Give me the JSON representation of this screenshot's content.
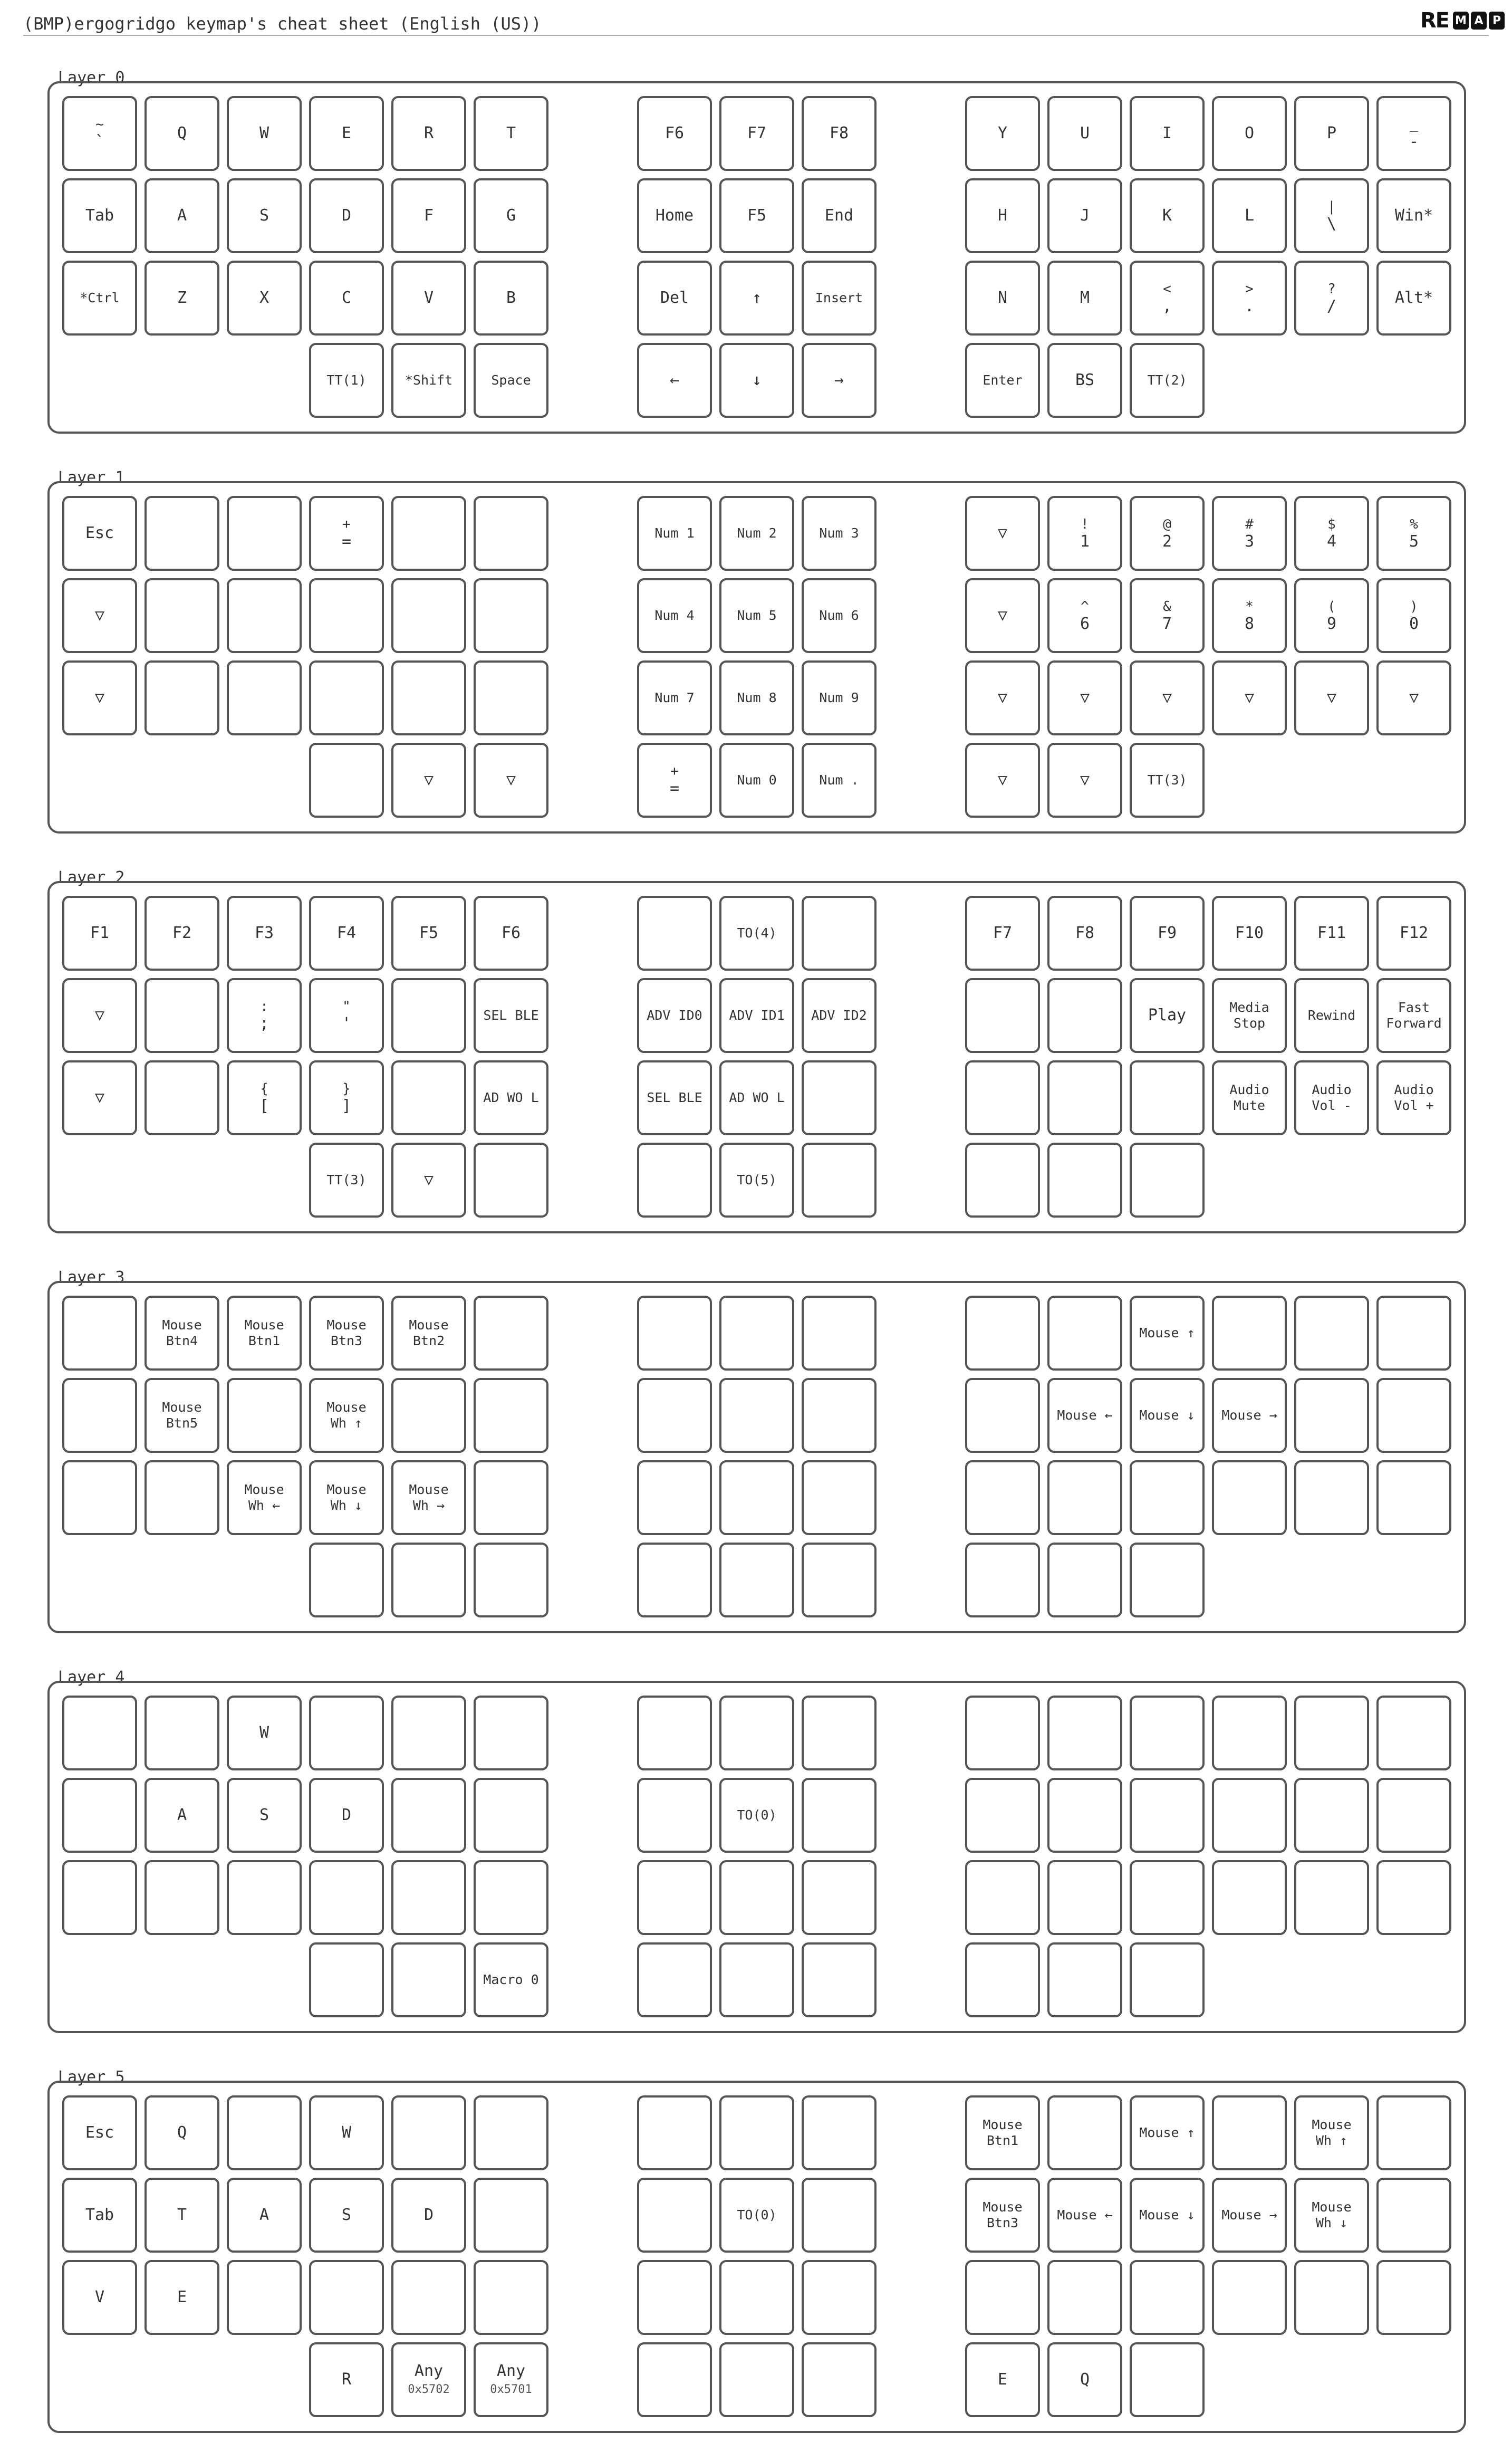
{
  "header": {
    "title": "(BMP)ergogridgo keymap's cheat sheet (English (US))",
    "logo_text": "RE",
    "logo_boxes": [
      "M",
      "A",
      "P"
    ]
  },
  "layers": [
    {
      "label": "Layer 0",
      "rows": [
        [
          {
            "top": "~",
            "main": "`"
          },
          {
            "main": "Q"
          },
          {
            "main": "W"
          },
          {
            "main": "E"
          },
          {
            "main": "R"
          },
          {
            "main": "T"
          },
          {
            "main": "F6"
          },
          {
            "main": "F7"
          },
          {
            "main": "F8"
          },
          {
            "main": "Y"
          },
          {
            "main": "U"
          },
          {
            "main": "I"
          },
          {
            "main": "O"
          },
          {
            "main": "P"
          },
          {
            "top": "_",
            "main": "-"
          }
        ],
        [
          {
            "main": "Tab"
          },
          {
            "main": "A"
          },
          {
            "main": "S"
          },
          {
            "main": "D"
          },
          {
            "main": "F"
          },
          {
            "main": "G"
          },
          {
            "main": "Home"
          },
          {
            "main": "F5"
          },
          {
            "main": "End"
          },
          {
            "main": "H"
          },
          {
            "main": "J"
          },
          {
            "main": "K"
          },
          {
            "main": "L"
          },
          {
            "top": "|",
            "main": "\\"
          },
          {
            "main": "Win*"
          }
        ],
        [
          {
            "main": "*Ctrl",
            "sm": true
          },
          {
            "main": "Z"
          },
          {
            "main": "X"
          },
          {
            "main": "C"
          },
          {
            "main": "V"
          },
          {
            "main": "B"
          },
          {
            "main": "Del"
          },
          {
            "main": "↑"
          },
          {
            "main": "Insert",
            "sm": true
          },
          {
            "main": "N"
          },
          {
            "main": "M"
          },
          {
            "top": "<",
            "main": ","
          },
          {
            "top": ">",
            "main": "."
          },
          {
            "top": "?",
            "main": "/"
          },
          {
            "main": "Alt*"
          }
        ],
        [
          null,
          null,
          null,
          {
            "main": "TT(1)",
            "sm": true
          },
          {
            "main": "*Shift",
            "sm": true
          },
          {
            "main": "Space",
            "sm": true
          },
          {
            "main": "←"
          },
          {
            "main": "↓"
          },
          {
            "main": "→"
          },
          {
            "main": "Enter",
            "sm": true
          },
          {
            "main": "BS"
          },
          {
            "main": "TT(2)",
            "sm": true
          },
          null,
          null,
          null
        ]
      ]
    },
    {
      "label": "Layer 1",
      "rows": [
        [
          {
            "main": "Esc"
          },
          {},
          {},
          {
            "top": "+",
            "main": "="
          },
          {},
          {},
          {
            "main": "Num 1",
            "sm": true
          },
          {
            "main": "Num 2",
            "sm": true
          },
          {
            "main": "Num 3",
            "sm": true
          },
          {
            "main": "▽"
          },
          {
            "top": "!",
            "main": "1"
          },
          {
            "top": "@",
            "main": "2"
          },
          {
            "top": "#",
            "main": "3"
          },
          {
            "top": "$",
            "main": "4"
          },
          {
            "top": "%",
            "main": "5"
          }
        ],
        [
          {
            "main": "▽"
          },
          {},
          {},
          {},
          {},
          {},
          {
            "main": "Num 4",
            "sm": true
          },
          {
            "main": "Num 5",
            "sm": true
          },
          {
            "main": "Num 6",
            "sm": true
          },
          {
            "main": "▽"
          },
          {
            "top": "^",
            "main": "6"
          },
          {
            "top": "&",
            "main": "7"
          },
          {
            "top": "*",
            "main": "8"
          },
          {
            "top": "(",
            "main": "9"
          },
          {
            "top": ")",
            "main": "0"
          }
        ],
        [
          {
            "main": "▽"
          },
          {},
          {},
          {},
          {},
          {},
          {
            "main": "Num 7",
            "sm": true
          },
          {
            "main": "Num 8",
            "sm": true
          },
          {
            "main": "Num 9",
            "sm": true
          },
          {
            "main": "▽"
          },
          {
            "main": "▽"
          },
          {
            "main": "▽"
          },
          {
            "main": "▽"
          },
          {
            "main": "▽"
          },
          {
            "main": "▽"
          }
        ],
        [
          null,
          null,
          null,
          {},
          {
            "main": "▽"
          },
          {
            "main": "▽"
          },
          {
            "top": "+",
            "main": "="
          },
          {
            "main": "Num 0",
            "sm": true
          },
          {
            "main": "Num .",
            "sm": true
          },
          {
            "main": "▽"
          },
          {
            "main": "▽"
          },
          {
            "main": "TT(3)",
            "sm": true
          },
          null,
          null,
          null
        ]
      ]
    },
    {
      "label": "Layer 2",
      "rows": [
        [
          {
            "main": "F1"
          },
          {
            "main": "F2"
          },
          {
            "main": "F3"
          },
          {
            "main": "F4"
          },
          {
            "main": "F5"
          },
          {
            "main": "F6"
          },
          {},
          {
            "main": "TO(4)",
            "sm": true
          },
          {},
          {
            "main": "F7"
          },
          {
            "main": "F8"
          },
          {
            "main": "F9"
          },
          {
            "main": "F10"
          },
          {
            "main": "F11"
          },
          {
            "main": "F12"
          }
        ],
        [
          {
            "main": "▽"
          },
          {},
          {
            "top": ":",
            "main": ";"
          },
          {
            "top": "\"",
            "main": "'"
          },
          {},
          {
            "main": "SEL BLE",
            "sm": true
          },
          {
            "main": "ADV ID0",
            "sm": true
          },
          {
            "main": "ADV ID1",
            "sm": true
          },
          {
            "main": "ADV ID2",
            "sm": true
          },
          {},
          {},
          {
            "main": "Play"
          },
          {
            "main": "Media\nStop",
            "sm": true
          },
          {
            "main": "Rewind",
            "sm": true
          },
          {
            "main": "Fast\nForward",
            "sm": true
          }
        ],
        [
          {
            "main": "▽"
          },
          {},
          {
            "top": "{",
            "main": "["
          },
          {
            "top": "}",
            "main": "]"
          },
          {},
          {
            "main": "AD WO L",
            "sm": true
          },
          {
            "main": "SEL BLE",
            "sm": true
          },
          {
            "main": "AD WO L",
            "sm": true
          },
          {},
          {},
          {},
          {},
          {
            "main": "Audio\nMute",
            "sm": true
          },
          {
            "main": "Audio\nVol -",
            "sm": true
          },
          {
            "main": "Audio\nVol +",
            "sm": true
          }
        ],
        [
          null,
          null,
          null,
          {
            "main": "TT(3)",
            "sm": true
          },
          {
            "main": "▽"
          },
          {},
          {},
          {
            "main": "TO(5)",
            "sm": true
          },
          {},
          {},
          {},
          {},
          null,
          null,
          null
        ]
      ]
    },
    {
      "label": "Layer 3",
      "rows": [
        [
          {},
          {
            "main": "Mouse\nBtn4",
            "sm": true
          },
          {
            "main": "Mouse\nBtn1",
            "sm": true
          },
          {
            "main": "Mouse\nBtn3",
            "sm": true
          },
          {
            "main": "Mouse\nBtn2",
            "sm": true
          },
          {},
          {},
          {},
          {},
          {},
          {},
          {
            "main": "Mouse ↑",
            "sm": true
          },
          {},
          {},
          {}
        ],
        [
          {},
          {
            "main": "Mouse\nBtn5",
            "sm": true
          },
          {},
          {
            "main": "Mouse\nWh ↑",
            "sm": true
          },
          {},
          {},
          {},
          {},
          {},
          {},
          {
            "main": "Mouse ←",
            "sm": true
          },
          {
            "main": "Mouse ↓",
            "sm": true
          },
          {
            "main": "Mouse →",
            "sm": true
          },
          {},
          {}
        ],
        [
          {},
          {},
          {
            "main": "Mouse\nWh ←",
            "sm": true
          },
          {
            "main": "Mouse\nWh ↓",
            "sm": true
          },
          {
            "main": "Mouse\nWh →",
            "sm": true
          },
          {},
          {},
          {},
          {},
          {},
          {},
          {},
          {},
          {},
          {}
        ],
        [
          null,
          null,
          null,
          {},
          {},
          {},
          {},
          {},
          {},
          {},
          {},
          {},
          null,
          null,
          null
        ]
      ]
    },
    {
      "label": "Layer 4",
      "rows": [
        [
          {},
          {},
          {
            "main": "W"
          },
          {},
          {},
          {},
          {},
          {},
          {},
          {},
          {},
          {},
          {},
          {},
          {}
        ],
        [
          {},
          {
            "main": "A"
          },
          {
            "main": "S"
          },
          {
            "main": "D"
          },
          {},
          {},
          {},
          {
            "main": "TO(0)",
            "sm": true
          },
          {},
          {},
          {},
          {},
          {},
          {},
          {}
        ],
        [
          {},
          {},
          {},
          {},
          {},
          {},
          {},
          {},
          {},
          {},
          {},
          {},
          {},
          {},
          {}
        ],
        [
          null,
          null,
          null,
          {},
          {},
          {
            "main": "Macro 0",
            "sm": true
          },
          {},
          {},
          {},
          {},
          {},
          {},
          null,
          null,
          null
        ]
      ]
    },
    {
      "label": "Layer 5",
      "rows": [
        [
          {
            "main": "Esc"
          },
          {
            "main": "Q"
          },
          {},
          {
            "main": "W"
          },
          {},
          {},
          {},
          {},
          {},
          {
            "main": "Mouse\nBtn1",
            "sm": true
          },
          {},
          {
            "main": "Mouse ↑",
            "sm": true
          },
          {},
          {
            "main": "Mouse\nWh ↑",
            "sm": true
          },
          {}
        ],
        [
          {
            "main": "Tab"
          },
          {
            "main": "T"
          },
          {
            "main": "A"
          },
          {
            "main": "S"
          },
          {
            "main": "D"
          },
          {},
          {},
          {
            "main": "TO(0)",
            "sm": true
          },
          {},
          {
            "main": "Mouse\nBtn3",
            "sm": true
          },
          {
            "main": "Mouse ←",
            "sm": true
          },
          {
            "main": "Mouse ↓",
            "sm": true
          },
          {
            "main": "Mouse →",
            "sm": true
          },
          {
            "main": "Mouse\nWh ↓",
            "sm": true
          },
          {}
        ],
        [
          {
            "main": "V"
          },
          {
            "main": "E"
          },
          {},
          {},
          {},
          {},
          {},
          {},
          {},
          {},
          {},
          {},
          {},
          {},
          {}
        ],
        [
          null,
          null,
          null,
          {
            "main": "R"
          },
          {
            "main": "Any",
            "sub": "0x5702"
          },
          {
            "main": "Any",
            "sub": "0x5701"
          },
          {},
          {},
          {},
          {
            "main": "E"
          },
          {
            "main": "Q"
          },
          {},
          null,
          null,
          null
        ]
      ]
    }
  ]
}
